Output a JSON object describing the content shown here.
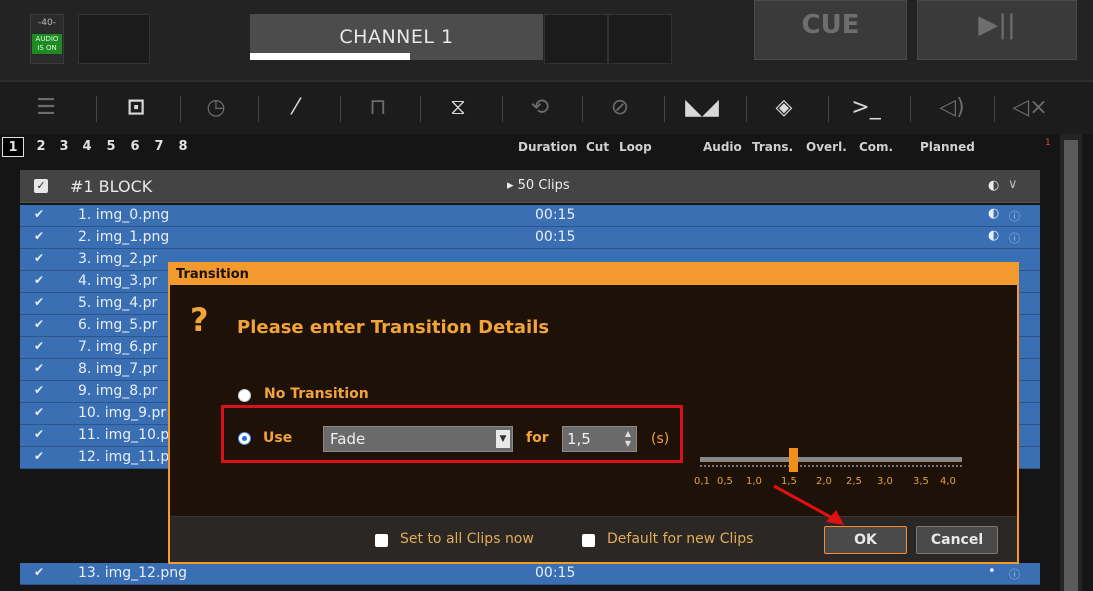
{
  "topbar": {
    "audio_level": "-40-",
    "audio_status": "AUDIO IS ON",
    "channel_title": "CHANNEL 1",
    "cue_label": "CUE",
    "play_label": "▶||"
  },
  "toolbar": {
    "icons": [
      "list-icon",
      "block-icon",
      "clock-play-icon",
      "magic-wand-icon",
      "crop-icon",
      "timer-icon",
      "loop-icon",
      "no-loop-icon",
      "audio-fade-icon",
      "layers-icon",
      "command-icon",
      "speaker-icon",
      "mute-icon"
    ]
  },
  "tabs": {
    "items": [
      "1",
      "2",
      "3",
      "4",
      "5",
      "6",
      "7",
      "8"
    ],
    "active": "1"
  },
  "columns": {
    "duration": "Duration",
    "cut": "Cut",
    "loop": "Loop",
    "audio": "Audio",
    "trans": "Trans.",
    "overl": "Overl.",
    "com": "Com.",
    "planned": "Planned"
  },
  "scrollbar": {
    "marker": "1"
  },
  "block": {
    "title": "#1 BLOCK",
    "clips": "▸ 50 Clips",
    "icon_a": "◐",
    "icon_b": "∨"
  },
  "rows": [
    {
      "name": "1. img_0.png",
      "duration": "00:15"
    },
    {
      "name": "2. img_1.png",
      "duration": "00:15"
    },
    {
      "name": "3. img_2.pr",
      "duration": ""
    },
    {
      "name": "4. img_3.pr",
      "duration": ""
    },
    {
      "name": "5. img_4.pr",
      "duration": ""
    },
    {
      "name": "6. img_5.pr",
      "duration": ""
    },
    {
      "name": "7. img_6.pr",
      "duration": ""
    },
    {
      "name": "8. img_7.pr",
      "duration": ""
    },
    {
      "name": "9. img_8.pr",
      "duration": ""
    },
    {
      "name": "10. img_9.pr",
      "duration": ""
    },
    {
      "name": "11. img_10.p",
      "duration": ""
    },
    {
      "name": "12. img_11.p",
      "duration": ""
    },
    {
      "name": "13. img_12.png",
      "duration": "00:15"
    }
  ],
  "dialog": {
    "title": "Transition",
    "heading": "Please enter Transition Details",
    "option_none": "No Transition",
    "option_use": "Use",
    "transition_type": "Fade",
    "for_label": "for",
    "duration_value": "1,5",
    "unit": "(s)",
    "slider_ticks": [
      "0,1",
      "0,5",
      "1,0",
      "1,5",
      "2,0",
      "2,5",
      "3,0",
      "3,5",
      "4,0"
    ],
    "slider_value": 1.5,
    "set_all_label": "Set to all Clips now",
    "default_label": "Default for new Clips",
    "ok_label": "OK",
    "cancel_label": "Cancel"
  },
  "colors": {
    "accent": "#f29a2e",
    "row_blue": "#3b6fb3",
    "highlight_red": "#d8111b"
  }
}
